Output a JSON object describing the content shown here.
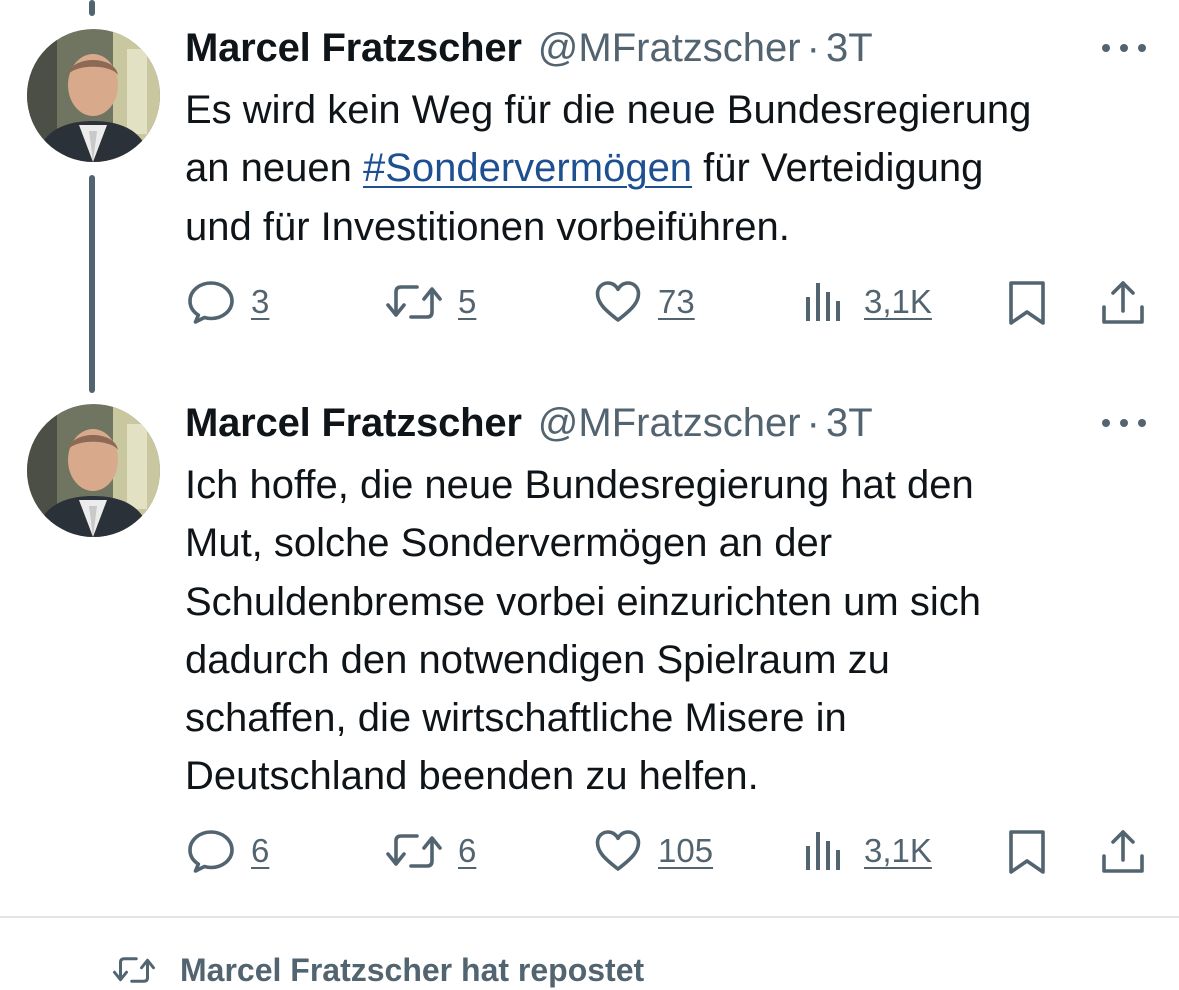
{
  "tweets": [
    {
      "author_name": "Marcel Fratzscher",
      "handle": "@MFratzscher",
      "separator": "·",
      "time": "3T",
      "text_lines": [
        {
          "before": "Es wird kein Weg für die neue Bundesregierung",
          "hashtag": "",
          "after": ""
        },
        {
          "before": "an neuen ",
          "hashtag": "#Sondervermögen",
          "after": " für Verteidigung"
        },
        {
          "before": "und für Investitionen vorbeiführen.",
          "hashtag": "",
          "after": ""
        }
      ],
      "actions": {
        "replies": "3",
        "reposts": "5",
        "likes": "73",
        "views": "3,1K"
      }
    },
    {
      "author_name": "Marcel Fratzscher",
      "handle": "@MFratzscher",
      "separator": "·",
      "time": "3T",
      "text_lines": [
        "Ich hoffe, die neue Bundesregierung hat den",
        "Mut, solche Sondervermögen an der",
        "Schuldenbremse vorbei einzurichten um sich",
        "dadurch den notwendigen Spielraum zu",
        "schaffen, die wirtschaftliche Misere in",
        "Deutschland beenden zu helfen."
      ],
      "actions": {
        "replies": "6",
        "reposts": "6",
        "likes": "105",
        "views": "3,1K"
      }
    }
  ],
  "next_item": {
    "icon": "retweet-icon",
    "text": "Marcel Fratzscher hat repostet"
  },
  "icons": {
    "reply": "reply-icon",
    "repost": "retweet-icon",
    "like": "heart-icon",
    "views": "views-icon",
    "bookmark": "bookmark-icon",
    "share": "share-icon",
    "more": "more-icon"
  },
  "colors": {
    "text": "#0f1419",
    "secondary": "#536471",
    "hashtag": "#1d4f91",
    "divider": "#e1e5e8",
    "thread_line": "#536471"
  }
}
